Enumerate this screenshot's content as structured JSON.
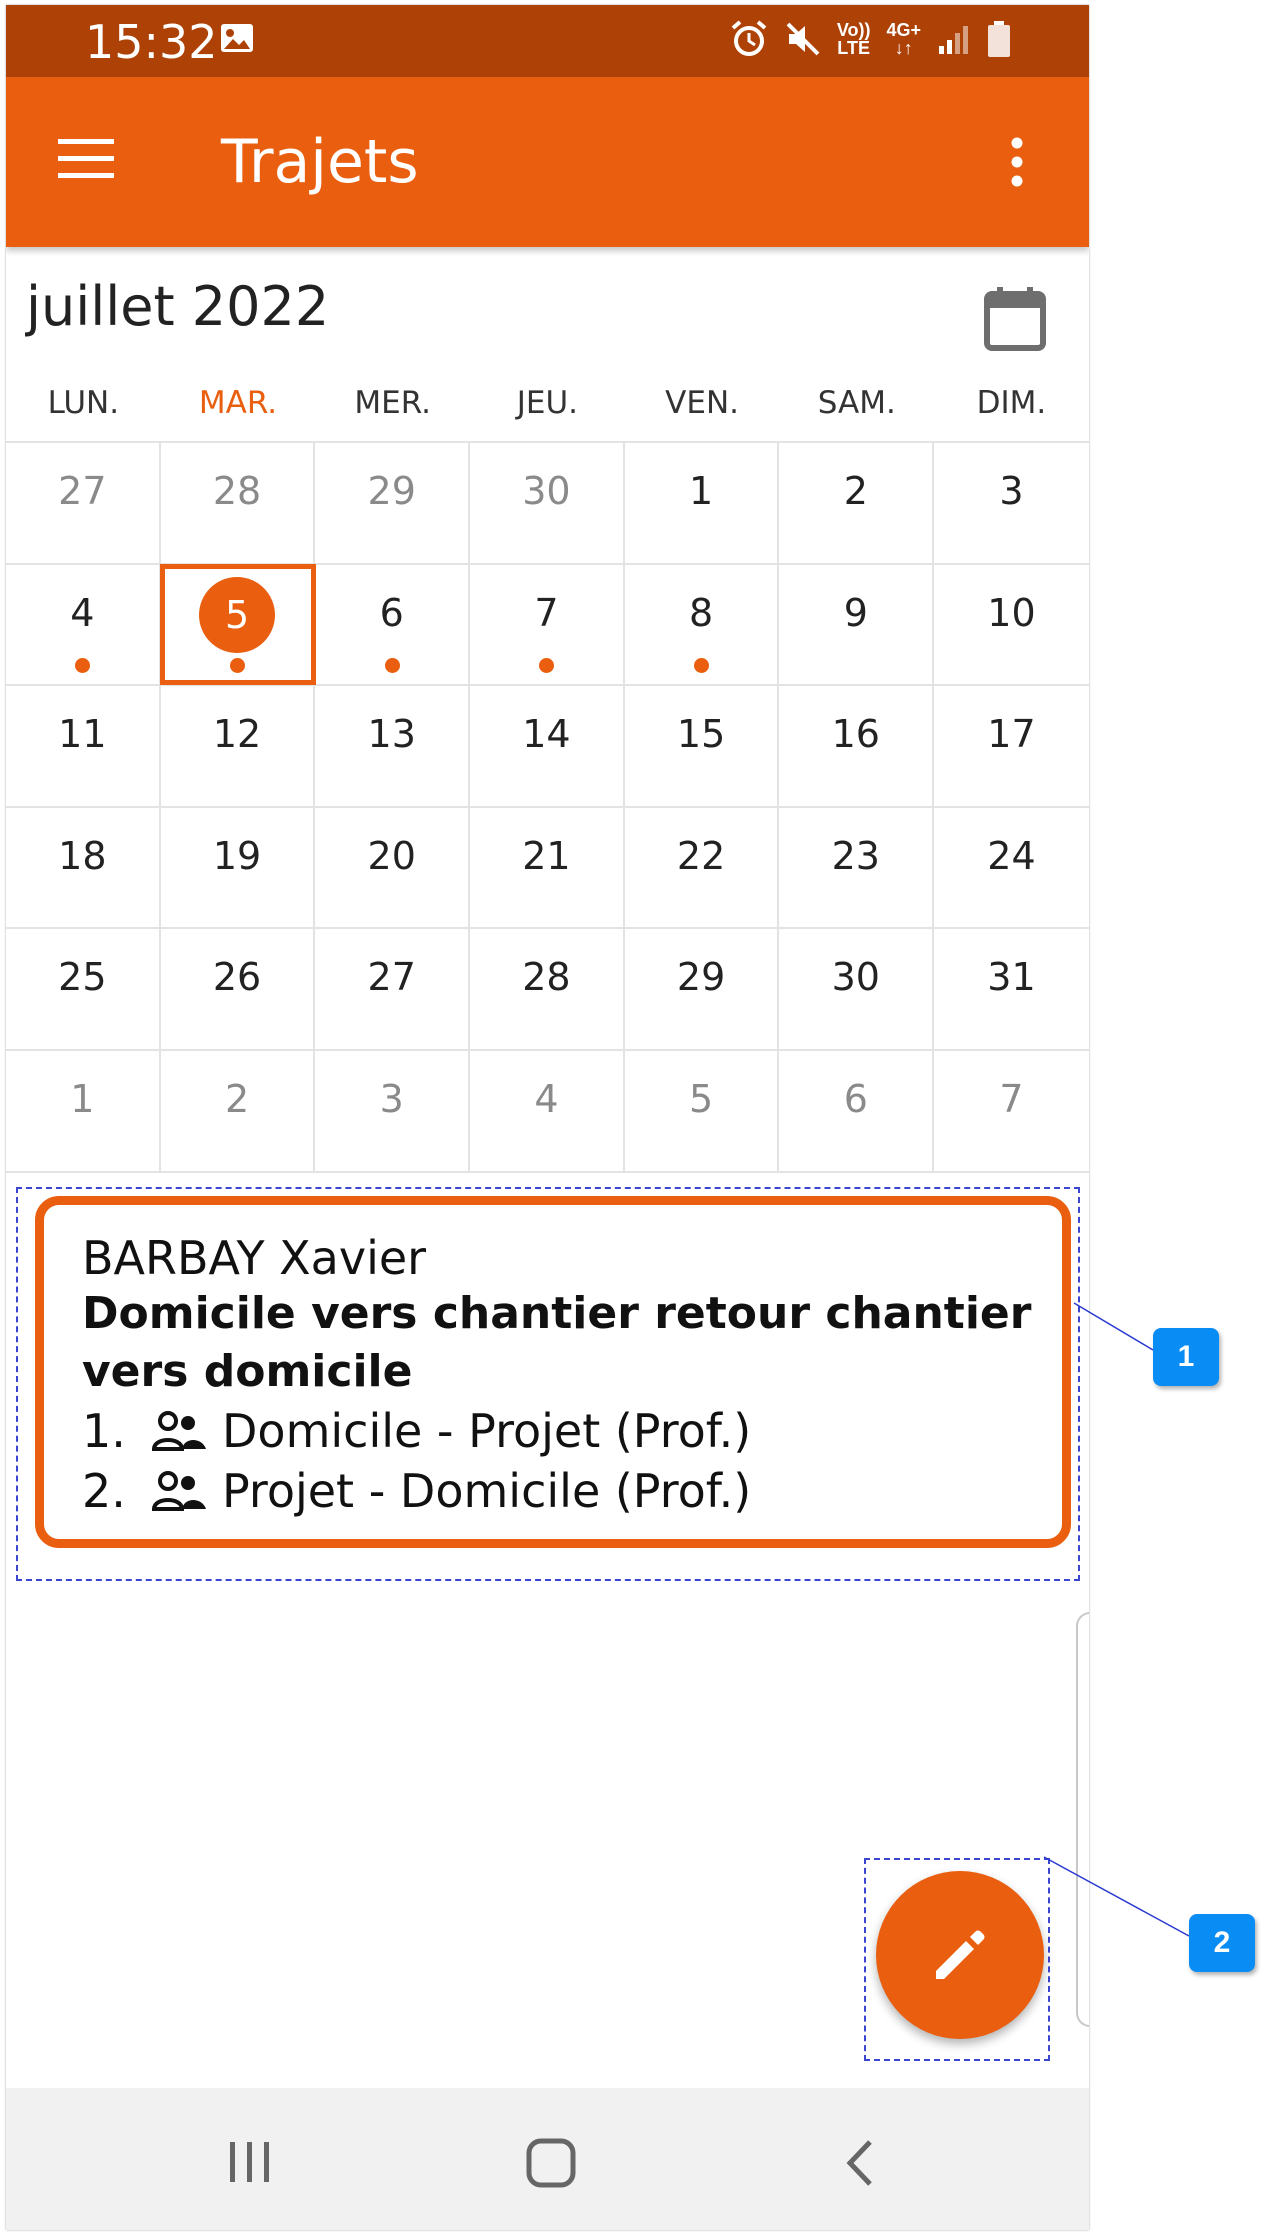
{
  "status_bar": {
    "time": "15:32",
    "network_label_top": "Vo))",
    "network_label_bottom": "LTE",
    "data_label": "4G+"
  },
  "app_bar": {
    "title": "Trajets",
    "menu_icon": "hamburger-menu-icon",
    "overflow_icon": "more-vertical-icon"
  },
  "calendar": {
    "month_label": "juillet 2022",
    "picker_icon": "calendar-icon",
    "weekdays": [
      "LUN.",
      "MAR.",
      "MER.",
      "JEU.",
      "VEN.",
      "SAM.",
      "DIM."
    ],
    "today_weekday_index": 1,
    "weeks": [
      [
        {
          "n": "27",
          "other": true
        },
        {
          "n": "28",
          "other": true
        },
        {
          "n": "29",
          "other": true
        },
        {
          "n": "30",
          "other": true
        },
        {
          "n": "1"
        },
        {
          "n": "2"
        },
        {
          "n": "3"
        }
      ],
      [
        {
          "n": "4",
          "dot": true
        },
        {
          "n": "5",
          "dot": true,
          "selected": true
        },
        {
          "n": "6",
          "dot": true
        },
        {
          "n": "7",
          "dot": true
        },
        {
          "n": "8",
          "dot": true
        },
        {
          "n": "9"
        },
        {
          "n": "10"
        }
      ],
      [
        {
          "n": "11"
        },
        {
          "n": "12"
        },
        {
          "n": "13"
        },
        {
          "n": "14"
        },
        {
          "n": "15"
        },
        {
          "n": "16"
        },
        {
          "n": "17"
        }
      ],
      [
        {
          "n": "18"
        },
        {
          "n": "19"
        },
        {
          "n": "20"
        },
        {
          "n": "21"
        },
        {
          "n": "22"
        },
        {
          "n": "23"
        },
        {
          "n": "24"
        }
      ],
      [
        {
          "n": "25"
        },
        {
          "n": "26"
        },
        {
          "n": "27"
        },
        {
          "n": "28"
        },
        {
          "n": "29"
        },
        {
          "n": "30"
        },
        {
          "n": "31"
        }
      ],
      [
        {
          "n": "1",
          "other": true
        },
        {
          "n": "2",
          "other": true
        },
        {
          "n": "3",
          "other": true
        },
        {
          "n": "4",
          "other": true
        },
        {
          "n": "5",
          "other": true
        },
        {
          "n": "6",
          "other": true
        },
        {
          "n": "7",
          "other": true
        }
      ]
    ]
  },
  "trip_card": {
    "person": "BARBAY Xavier",
    "title": "Domicile vers chantier retour chantier vers domicile",
    "legs": [
      {
        "index": "1.",
        "icon": "carpool-people-icon",
        "label": "Domicile - Projet (Prof.)"
      },
      {
        "index": "2.",
        "icon": "carpool-people-icon",
        "label": "Projet - Domicile (Prof.)"
      }
    ]
  },
  "fab": {
    "icon": "pencil-edit-icon"
  },
  "callouts": [
    "1",
    "2"
  ],
  "colors": {
    "accent": "#e95e0f",
    "status_bar": "#ad4106",
    "callout": "#0a8cf5"
  }
}
